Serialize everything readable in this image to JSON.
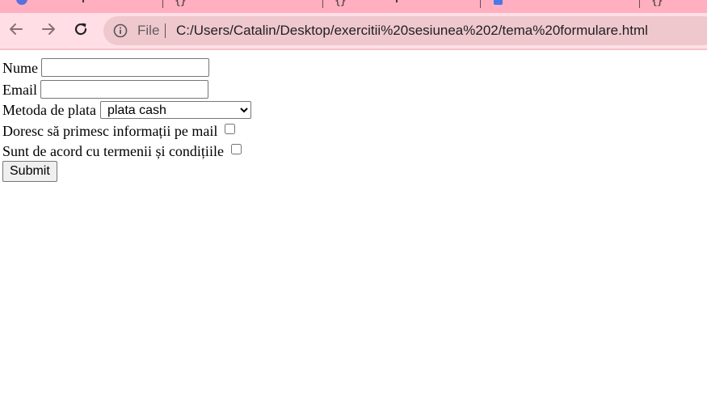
{
  "browser": {
    "omnibox": {
      "scheme_label": "File",
      "url": "C:/Users/Catalin/Desktop/exercitii%20sesiunea%202/tema%20formulare.html"
    },
    "colors": {
      "tabstrip": "#ffafc0",
      "toolbar": "#ffdfe5",
      "omnibox": "#efc8ce"
    },
    "icons": [
      "back-arrow-icon",
      "forward-arrow-icon",
      "reload-icon",
      "info-icon"
    ]
  },
  "form": {
    "nume_label": "Nume",
    "nume_value": "",
    "email_label": "Email",
    "email_value": "",
    "metoda_label": "Metoda de plata",
    "metoda_selected": "plata cash",
    "newsletter_label": "Doresc să primesc informații pe mail",
    "newsletter_checked": false,
    "terms_label": "Sunt de acord cu termenii și condițiile",
    "terms_checked": false,
    "submit_label": "Submit"
  }
}
